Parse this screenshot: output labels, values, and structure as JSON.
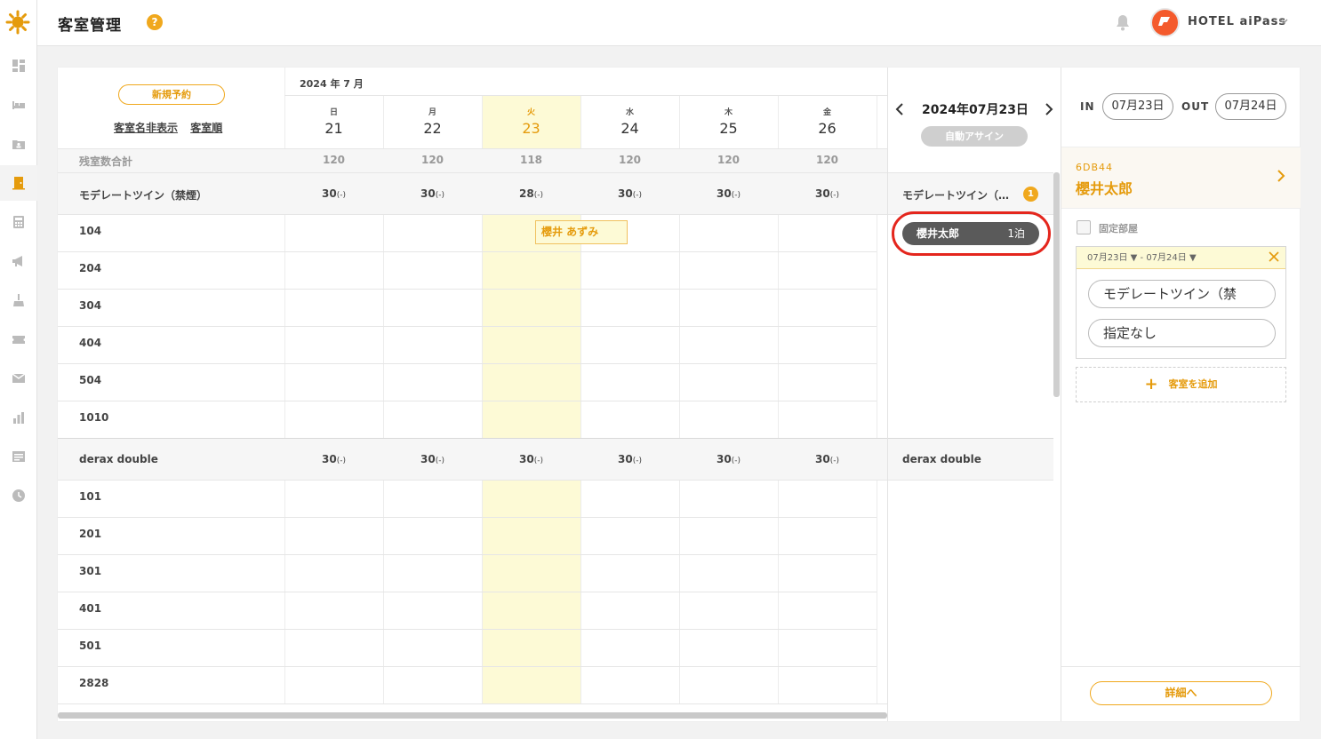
{
  "header": {
    "title": "客室管理",
    "help_label": "?",
    "hotel_name": "HOTEL aiPass"
  },
  "sidebar": {
    "items": [
      {
        "icon": "dashboard-icon"
      },
      {
        "icon": "bed-icon"
      },
      {
        "icon": "contact-card-icon"
      },
      {
        "icon": "door-icon",
        "active": true
      },
      {
        "icon": "calculator-icon"
      },
      {
        "icon": "megaphone-icon"
      },
      {
        "icon": "cleaning-icon"
      },
      {
        "icon": "ticket-icon"
      },
      {
        "icon": "mail-icon"
      },
      {
        "icon": "bar-chart-icon"
      },
      {
        "icon": "list-icon"
      },
      {
        "icon": "clock-icon"
      }
    ]
  },
  "calendar": {
    "new_reservation_label": "新規予約",
    "hide_names_link": "客室名非表示",
    "room_order_link": "客室順",
    "month_label": "2024 年 7 月",
    "days": [
      {
        "dow": "日",
        "num": "21"
      },
      {
        "dow": "月",
        "num": "22"
      },
      {
        "dow": "火",
        "num": "23",
        "today": true
      },
      {
        "dow": "水",
        "num": "24"
      },
      {
        "dow": "木",
        "num": "25"
      },
      {
        "dow": "金",
        "num": "26"
      }
    ],
    "remaining_label": "残室数合計",
    "remaining_totals": [
      "120",
      "120",
      "118",
      "120",
      "120",
      "120"
    ],
    "room_types": [
      {
        "name": "モデレートツイン（禁煙）",
        "counts": [
          "30",
          "30",
          "28",
          "30",
          "30",
          "30"
        ],
        "count_suffix": "(-)",
        "rooms": [
          "104",
          "204",
          "304",
          "404",
          "504",
          "1010"
        ]
      },
      {
        "name": "derax double",
        "counts": [
          "30",
          "30",
          "30",
          "30",
          "30",
          "30"
        ],
        "count_suffix": "(-)",
        "rooms": [
          "101",
          "201",
          "301",
          "401",
          "501",
          "2828"
        ]
      }
    ],
    "booking": {
      "guest": "櫻井 あずみ",
      "room": "104",
      "day": "23"
    }
  },
  "unassigned": {
    "date": "2024年07月23日",
    "auto_assign_label": "自動アサイン",
    "groups": [
      {
        "type": "モデレートツイン（…",
        "badge": "1",
        "guests": [
          {
            "name": "櫻井太郎",
            "stay": "1泊"
          }
        ]
      },
      {
        "type": "derax double",
        "guests": []
      }
    ]
  },
  "detail": {
    "in_label": "IN",
    "in_date": "07月23日",
    "out_label": "OUT",
    "out_date": "07月24日",
    "reservation_code": "6DB44",
    "guest_name": "櫻井太郎",
    "fixed_room_label": "固定部屋",
    "range_from": "07月23日 ▼",
    "range_sep": "-",
    "range_to": "07月24日 ▼",
    "room_type_value": "モデレートツイン（禁",
    "room_value": "指定なし",
    "add_room_label": "客室を追加",
    "detail_button": "詳細へ"
  },
  "colors": {
    "accent": "#f0a81d",
    "today_highlight": "#fdfad6",
    "annotation_ring": "#e4261d"
  }
}
